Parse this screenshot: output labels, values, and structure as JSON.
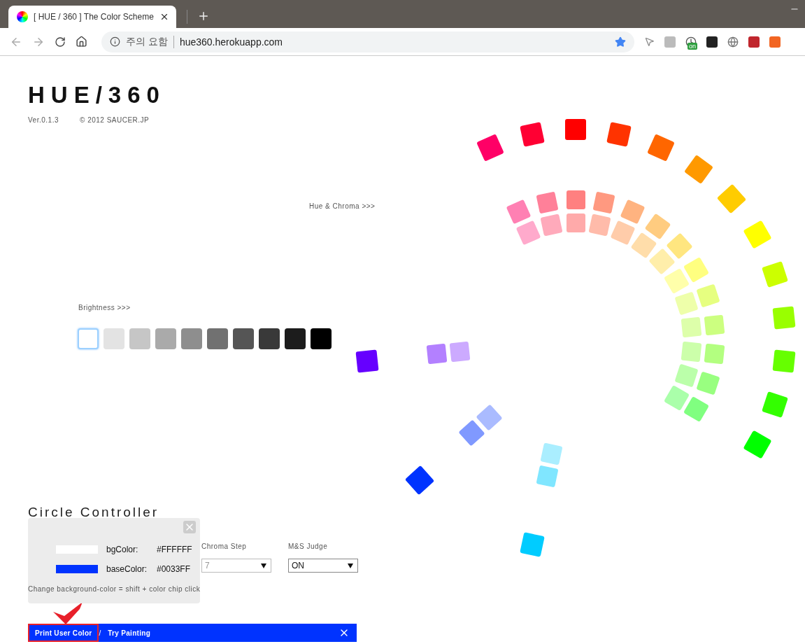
{
  "browser": {
    "tab_title": "[ HUE / 360 ] The Color Scheme",
    "security_label": "주의 요함",
    "url": "hue360.herokuapp.com",
    "bookmarked": true,
    "extension_badge": "on"
  },
  "header": {
    "logo": "HUE/360",
    "version": "Ver.0.1.3",
    "copyright": "© 2012 SAUCER.JP"
  },
  "hue_chroma_label": "Hue & Chroma >>>",
  "brightness": {
    "label": "Brightness >>>",
    "swatches": [
      {
        "color": "#ffffff",
        "selected": true
      },
      {
        "color": "#e3e3e3",
        "selected": false
      },
      {
        "color": "#c6c6c6",
        "selected": false
      },
      {
        "color": "#aaaaaa",
        "selected": false
      },
      {
        "color": "#8e8e8e",
        "selected": false
      },
      {
        "color": "#717171",
        "selected": false
      },
      {
        "color": "#555555",
        "selected": false
      },
      {
        "color": "#393939",
        "selected": false
      },
      {
        "color": "#1c1c1c",
        "selected": false
      },
      {
        "color": "#000000",
        "selected": false
      }
    ]
  },
  "wheel": {
    "chips": [
      {
        "color": "#ff0066"
      },
      {
        "color": "#ff0033"
      },
      {
        "color": "#ff0000"
      },
      {
        "color": "#ff3300"
      },
      {
        "color": "#ff6600"
      },
      {
        "color": "#ff9900"
      },
      {
        "color": "#ffcc00"
      },
      {
        "color": "#ffff00"
      },
      {
        "color": "#ccff00"
      },
      {
        "color": "#99ff00"
      },
      {
        "color": "#66ff00"
      },
      {
        "color": "#33ff00"
      },
      {
        "color": "#00ff00"
      },
      {
        "color": "#00ccff"
      },
      {
        "color": "#0033ff"
      },
      {
        "color": "#6600ff"
      },
      {
        "color": "#ff80b3"
      },
      {
        "color": "#ff8099"
      },
      {
        "color": "#ff8080"
      },
      {
        "color": "#ff9980"
      },
      {
        "color": "#ffb380"
      },
      {
        "color": "#ffcc80"
      },
      {
        "color": "#ffe680"
      },
      {
        "color": "#ffff80"
      },
      {
        "color": "#e6ff80"
      },
      {
        "color": "#ccff80"
      },
      {
        "color": "#b3ff80"
      },
      {
        "color": "#99ff80"
      },
      {
        "color": "#80ff80"
      },
      {
        "color": "#80e6ff"
      },
      {
        "color": "#8099ff"
      },
      {
        "color": "#b380ff"
      },
      {
        "color": "#ffaacc"
      },
      {
        "color": "#ffaabb"
      },
      {
        "color": "#ffaaaa"
      },
      {
        "color": "#ffbbaa"
      },
      {
        "color": "#ffccaa"
      },
      {
        "color": "#ffddaa"
      },
      {
        "color": "#ffeeaa"
      },
      {
        "color": "#ffffaa"
      },
      {
        "color": "#eeffaa"
      },
      {
        "color": "#ddffaa"
      },
      {
        "color": "#ccffaa"
      },
      {
        "color": "#bbffaa"
      },
      {
        "color": "#aaffaa"
      },
      {
        "color": "#aaeeff"
      },
      {
        "color": "#aabbff"
      },
      {
        "color": "#ccaaff"
      }
    ]
  },
  "controller": {
    "title": "Circle Controller",
    "fields": [
      {
        "kind": "select",
        "label": "Chroma Step",
        "value": "7",
        "disabled": true
      },
      {
        "kind": "select",
        "label": "M&S Judge",
        "value": "ON",
        "disabled": false
      }
    ],
    "hint": "Change background-color = shift + color chip click"
  },
  "popup": {
    "rows": [
      {
        "label": "bgColor:",
        "value": "#FFFFFF",
        "color": "#ffffff"
      },
      {
        "label": "baseColor:",
        "value": "#0033FF",
        "color": "#0033ff"
      }
    ]
  },
  "bottom_bar": {
    "separator": "/",
    "links": [
      {
        "label": "Print User Color",
        "highlighted": true
      },
      {
        "label": "Try Painting",
        "highlighted": false
      }
    ]
  }
}
